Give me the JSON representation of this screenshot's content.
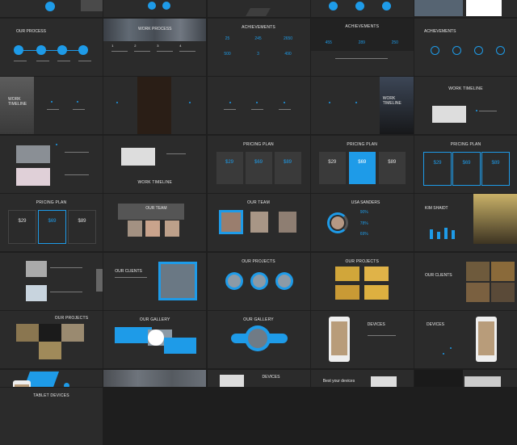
{
  "colors": {
    "accent": "#1e9be8",
    "bg": "#1e1e1e",
    "slide": "#2b2b2b"
  },
  "titles": {
    "our_process": "OUR PROCESS",
    "work_process": "WORK PROCESS",
    "achievements": "ACHIEVEMENTS",
    "work_timeline_a": "WORK TIMELINE",
    "work_timeline_b": "WORK TIMELINE",
    "work_timeline_c": "WORK TIMELINE",
    "pricing_plan": "PRICING PLAN",
    "our_team": "OUR TEAM",
    "usa_sanders": "USA SANDERS",
    "kim_shaidt": "KIM SHAIDT",
    "our_clients": "OUR CLIENTS",
    "our_projects": "OUR PROJECTS",
    "our_gallery": "OUR GALLERY",
    "devices": "DEVICES",
    "best_devices": "Best your devices",
    "tablet_devices": "TABLET DEVICES",
    "work": "WORK",
    "timeline": "TIMELINE"
  },
  "achievements": {
    "a1": [
      "25",
      "245",
      "2650"
    ],
    "a2": [
      "500",
      "3",
      "490"
    ],
    "b1": [
      "455",
      "289",
      "250"
    ]
  },
  "work_process_steps": [
    "1",
    "2",
    "3",
    "4"
  ],
  "pricing": {
    "p1": "$29",
    "p2": "$69",
    "p3": "$89"
  },
  "stats": {
    "s1": "90%",
    "s2": "78%",
    "s3": "69%"
  }
}
